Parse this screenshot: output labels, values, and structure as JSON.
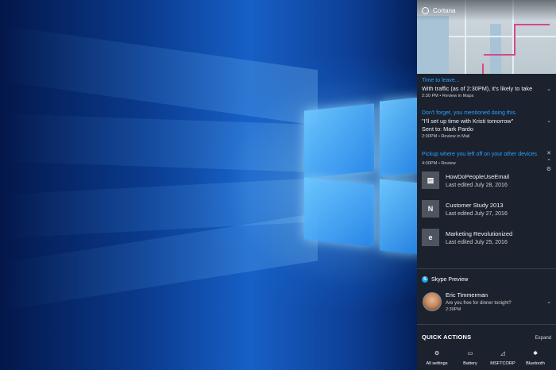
{
  "cortana": {
    "title": "Cortana"
  },
  "traffic": {
    "heading": "Time to leave...",
    "text": "With traffic (as of 2:30PM), it's likely to take",
    "time": "2:30 PM",
    "link": "Review in Maps"
  },
  "reminder": {
    "heading": "Don't forget, you mentioned doing this.",
    "quote": "\"I'll set up time with Kristi tomorrow\"",
    "sent": "Sent to: Mark Pardo",
    "time": "2:00PM",
    "link": "Review in Mail"
  },
  "pickup": {
    "heading": "Pickup where you left off on your other devices",
    "time": "4:00PM",
    "link": "Review",
    "documents": [
      {
        "name": "HowDoPeopleUseEmail",
        "date": "Last edited July 28, 2016",
        "icon": "document-icon",
        "glyph": "▤"
      },
      {
        "name": "Customer Study 2013",
        "date": "Last edited July 27, 2016",
        "icon": "onenote-icon",
        "glyph": "N"
      },
      {
        "name": "Marketing Revolutionized",
        "date": "Last edited July 25, 2016",
        "icon": "edge-icon",
        "glyph": "e"
      }
    ]
  },
  "skype": {
    "app": "Skype Preview",
    "sender": "Eric Timmerman",
    "message": "Are you free for dinner tonight?",
    "time": "2:30PM"
  },
  "quick_actions": {
    "title": "QUICK ACTIONS",
    "expand": "Expand",
    "tiles": [
      {
        "label": "All settings",
        "icon": "gear-icon",
        "glyph": "⚙"
      },
      {
        "label": "Battery",
        "icon": "battery-icon",
        "glyph": "▭"
      },
      {
        "label": "MSFTCORP",
        "icon": "wifi-icon",
        "glyph": "◿"
      },
      {
        "label": "Bluetooth",
        "icon": "bluetooth-icon",
        "glyph": "✱"
      }
    ]
  }
}
